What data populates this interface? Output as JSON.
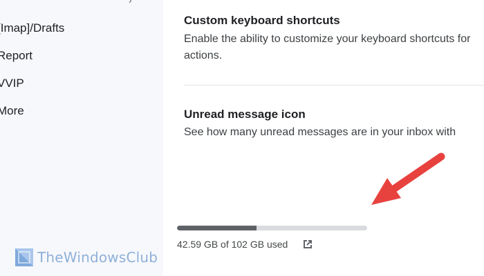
{
  "sidebar": {
    "items": [
      {
        "label": "[Imap]/Drafts"
      },
      {
        "label": "Report"
      },
      {
        "label": "VVIP"
      },
      {
        "label": "More"
      }
    ]
  },
  "settings": [
    {
      "title": "Custom keyboard shortcuts",
      "description": "Enable the ability to customize your keyboard shortcuts for actions."
    },
    {
      "title": "Unread message icon",
      "description": "See how many unread messages are in your inbox with"
    }
  ],
  "storage": {
    "usage_text": "42.59 GB of 102 GB used",
    "used_fraction": 0.4175,
    "icon": "open-in-new-icon"
  },
  "watermark": {
    "text": "TheWindowsClub"
  },
  "colors": {
    "sidebar_bg": "#f7f8fc",
    "storage_fill": "#5f6368",
    "storage_track": "#d9dbdf",
    "annotation_arrow": "#e8423f",
    "watermark": "#8fb0d8"
  }
}
